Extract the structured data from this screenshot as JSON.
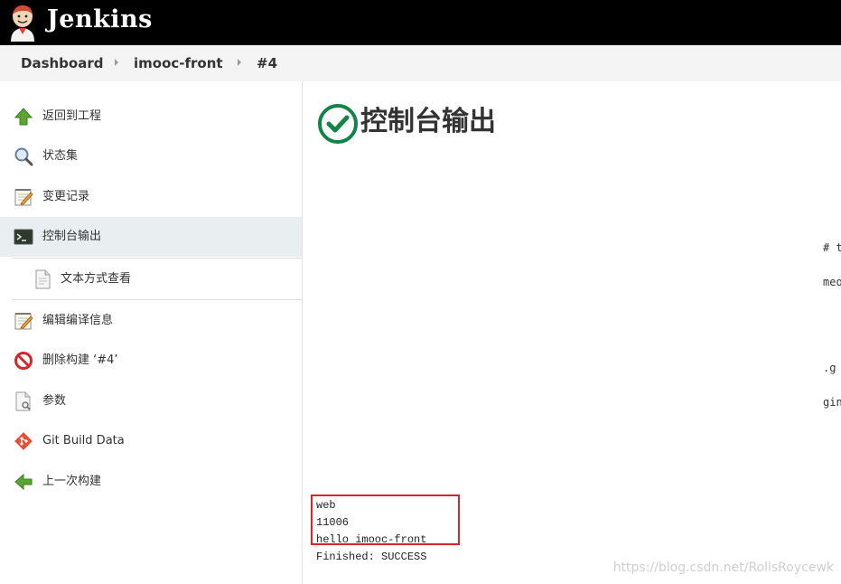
{
  "header": {
    "app_title": "Jenkins"
  },
  "breadcrumb": [
    {
      "label": "Dashboard"
    },
    {
      "label": "imooc-front"
    },
    {
      "label": "#4"
    }
  ],
  "sidebar": {
    "items": [
      {
        "label": "返回到工程",
        "icon": "up-arrow-icon"
      },
      {
        "label": "状态集",
        "icon": "search-icon"
      },
      {
        "label": "变更记录",
        "icon": "notepad-icon"
      },
      {
        "label": "控制台输出",
        "icon": "terminal-icon",
        "active": true
      },
      {
        "label": "文本方式查看",
        "icon": "document-icon",
        "sub": true
      },
      {
        "label": "编辑编译信息",
        "icon": "notepad-icon"
      },
      {
        "label": "删除构建 ‘#4’",
        "icon": "no-entry-icon"
      },
      {
        "label": "参数",
        "icon": "document-search-icon"
      },
      {
        "label": "Git Build Data",
        "icon": "git-icon"
      },
      {
        "label": "上一次构建",
        "icon": "left-arrow-icon"
      }
    ]
  },
  "main": {
    "title": "控制台输出",
    "status_icon": "success-check-icon",
    "status_color": "#138347",
    "right_fragments": [
      "# t",
      "meo",
      ".g",
      "gin"
    ],
    "output_lines": [
      "web",
      "11006",
      "hello imooc-front"
    ],
    "finished_line": "Finished: SUCCESS"
  },
  "watermark": "https://blog.csdn.net/RollsRoycewk"
}
